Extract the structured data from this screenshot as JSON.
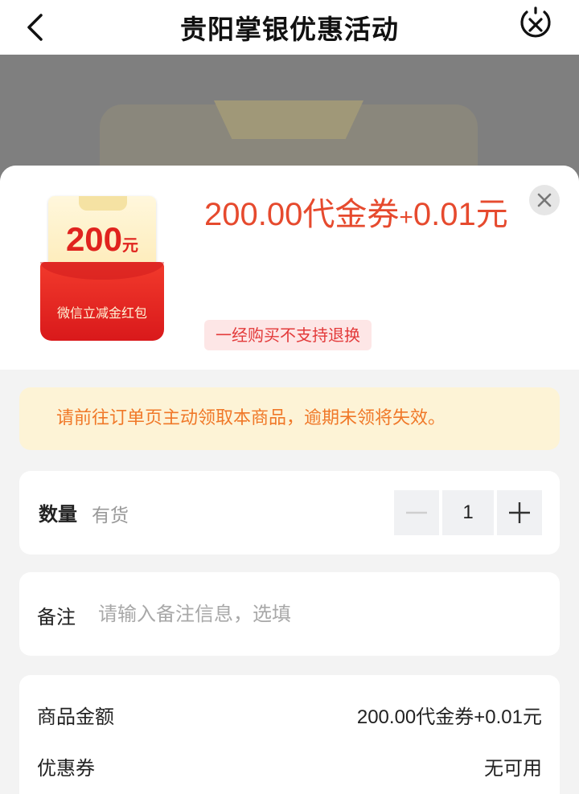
{
  "nav": {
    "title": "贵阳掌银优惠活动",
    "back_icon": "chevron-left-icon",
    "close_icon": "close-circle-icon"
  },
  "product": {
    "voucher_amount": "200",
    "voucher_unit": "元",
    "voucher_label": "微信立减金红包",
    "price_main": "200.00代金券",
    "price_plus": "+",
    "price_cash": "0.01元",
    "tag": "一经购买不支持退换"
  },
  "notice": "请前往订单页主动领取本商品，逾期未领将失效。",
  "quantity": {
    "label": "数量",
    "stock": "有货",
    "value": "1"
  },
  "note": {
    "label": "备注",
    "placeholder": "请输入备注信息，选填"
  },
  "summary": {
    "items": [
      {
        "label": "商品金额",
        "value": "200.00代金券+0.01元"
      },
      {
        "label": "优惠券",
        "value": "无可用"
      }
    ]
  },
  "colors": {
    "accent": "#e64a2e",
    "notice_bg": "#fdf3d6",
    "notice_text": "#f07828",
    "tag_bg": "#fde6e6",
    "tag_text": "#e33a3a"
  }
}
